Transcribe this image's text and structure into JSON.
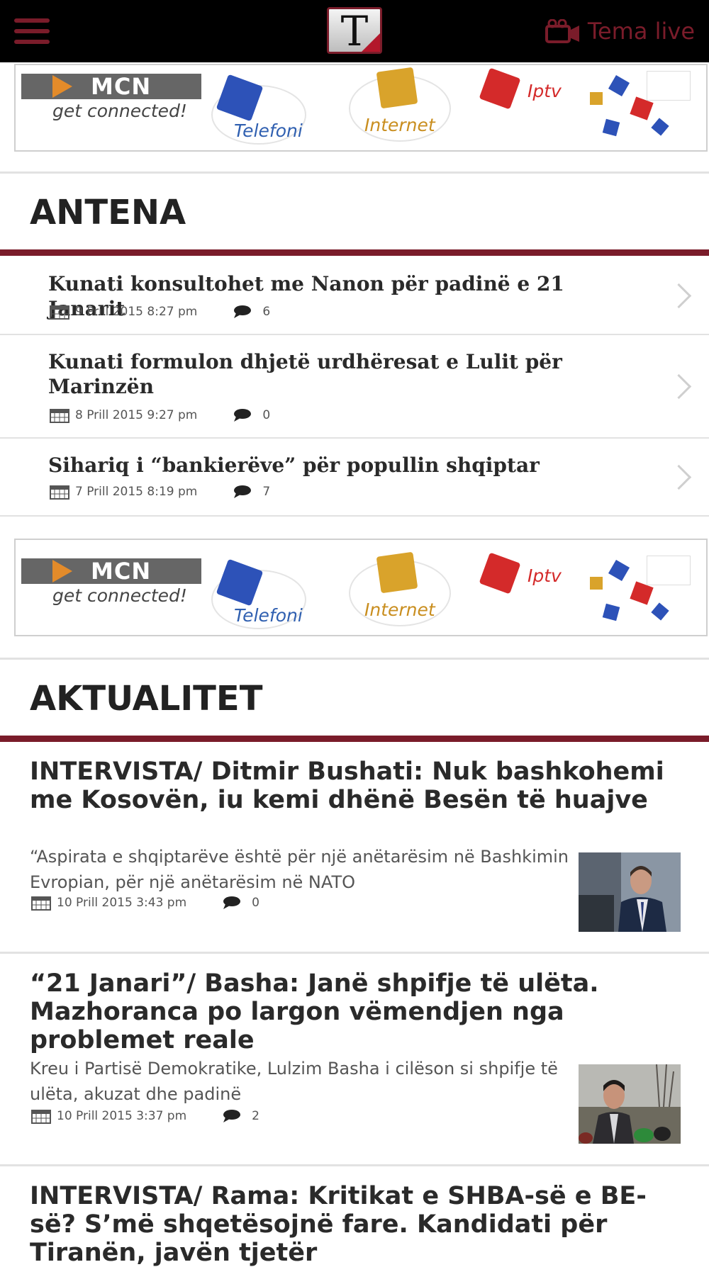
{
  "header": {
    "menu_icon": "hamburger-menu-icon",
    "logo_letter": "T",
    "live_label": "Tema live",
    "live_icon": "video-camera-icon",
    "accent": "#7a1c2a"
  },
  "ads": [
    {
      "brand": "MCN",
      "tagline": "get connected!",
      "services": [
        "Telefoni",
        "Internet",
        "Iptv"
      ]
    },
    {
      "brand": "MCN",
      "tagline": "get connected!",
      "services": [
        "Telefoni",
        "Internet",
        "Iptv"
      ]
    }
  ],
  "antena": {
    "title": "ANTENA",
    "items": [
      {
        "title": "Kunati konsultohet me Nanon për padinë e 21 Janarit",
        "date": "9 Prill 2015 8:27 pm",
        "comments": "6"
      },
      {
        "title": "Kunati formulon dhjetë urdhëresat e Lulit për Marinzën",
        "date": "8 Prill 2015 9:27 pm",
        "comments": "0"
      },
      {
        "title": "Sihariq i “bankierëve” për popullin shqiptar",
        "date": "7 Prill 2015 8:19 pm",
        "comments": "7"
      }
    ]
  },
  "aktualitet": {
    "title": "AKTUALITET",
    "articles": [
      {
        "title": "INTERVISTA/ Ditmir Bushati: Nuk bashkohemi me Kosovën, iu kemi dhënë Besën të huajve",
        "excerpt": "“Aspirata e shqiptarëve është për një anëtarësim në Bashkimin Evropian, për një anëtarësim në NATO",
        "date": "10 Prill 2015 3:43 pm",
        "comments": "0"
      },
      {
        "title": "“21 Janari”/ Basha: Janë shpifje të ulëta. Mazhoranca po largon vëmendjen nga problemet reale",
        "excerpt": "Kreu i Partisë Demokratike, Lulzim Basha i cilëson si shpifje të ulëta, akuzat dhe padinë",
        "date": "10 Prill 2015 3:37 pm",
        "comments": "2"
      },
      {
        "title": "INTERVISTA/ Rama: Kritikat e SHBA-së e BE-së? S’më shqetësojnë fare. Kandidati për Tiranën, javën tjetër"
      }
    ]
  }
}
